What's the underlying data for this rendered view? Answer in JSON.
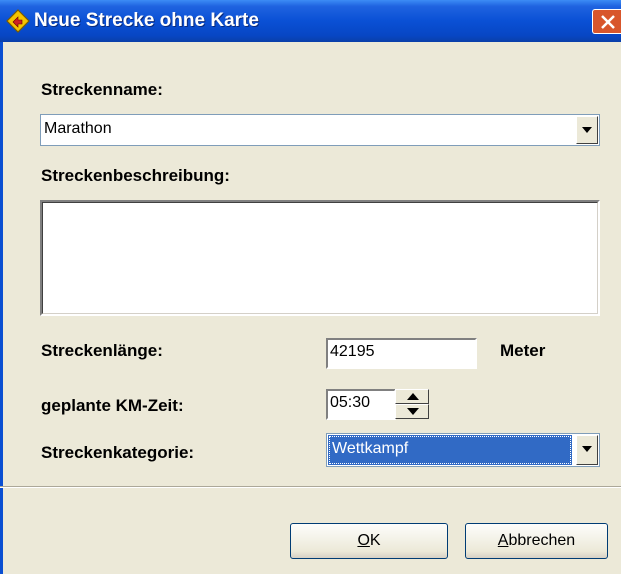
{
  "window": {
    "title": "Neue Strecke ohne Karte"
  },
  "labels": {
    "streckenname": "Streckenname:",
    "streckenbeschreibung": "Streckenbeschreibung:",
    "streckenlaenge": "Streckenlänge:",
    "km_zeit": "geplante KM-Zeit:",
    "kategorie": "Streckenkategorie:",
    "unit_meter": "Meter"
  },
  "fields": {
    "streckenname": "Marathon",
    "streckenbeschreibung": "",
    "streckenlaenge": "42195",
    "km_zeit": "05:30",
    "kategorie": "Wettkampf"
  },
  "buttons": {
    "ok_mnemonic": "O",
    "ok_rest": "K",
    "cancel_mnemonic": "A",
    "cancel_rest": "bbrechen"
  },
  "colors": {
    "title_bar": "#0a50d5",
    "selection": "#316ac5",
    "close": "#d8562c"
  }
}
